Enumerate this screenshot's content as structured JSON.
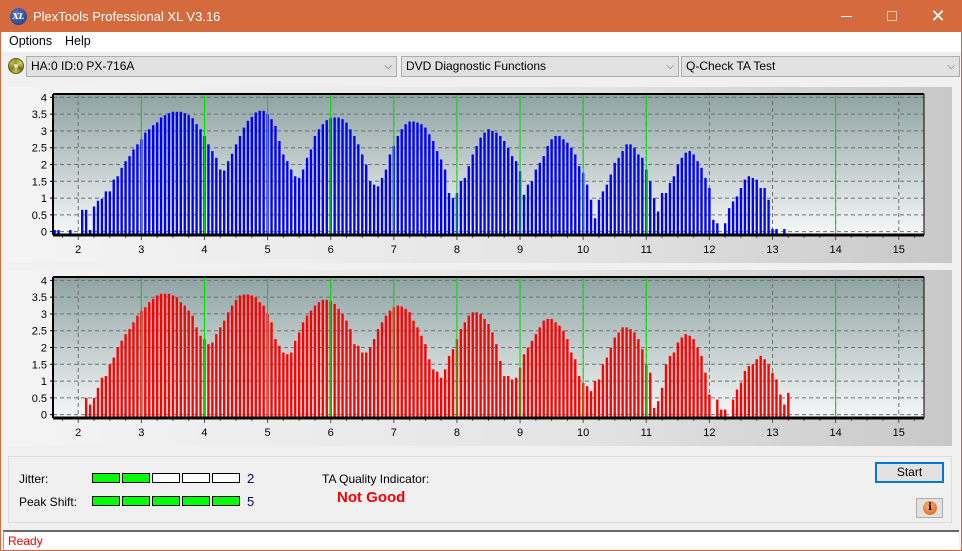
{
  "window": {
    "title": "PlexTools Professional XL V3.16",
    "app_icon_label": "XL",
    "controls": {
      "minimize": "—",
      "maximize": "☐",
      "close": "✕"
    }
  },
  "menu": {
    "items": [
      "Options",
      "Help"
    ]
  },
  "toolbar": {
    "drive": "HA:0 ID:0  PX-716A",
    "function": "DVD Diagnostic Functions",
    "test": "Q-Check TA Test",
    "chevron": "⌵"
  },
  "colors": {
    "titlebar": "#d46a3e",
    "top_bars": "#0000ff",
    "bottom_bars": "#ff0000",
    "marker_lines": "#00dd00",
    "meter_on": "#00ff00",
    "quality_bad": "#ff0000"
  },
  "chart_data": [
    {
      "type": "bar",
      "name": "top-histogram",
      "series_color": "#0000ff",
      "x_ticks": [
        2,
        3,
        4,
        5,
        6,
        7,
        8,
        9,
        10,
        11,
        12,
        13,
        14,
        15
      ],
      "y_ticks": [
        "0",
        "0.5",
        "1",
        "1.5",
        "2",
        "2.5",
        "3",
        "3.5",
        "4"
      ],
      "xlim": [
        1.6,
        15.4
      ],
      "ylim": [
        -0.1,
        4.1
      ],
      "grid": true,
      "marker_lines_x": [
        3,
        4,
        5,
        6,
        7,
        8,
        9,
        10,
        11,
        14
      ],
      "peaks": [
        {
          "center": 3,
          "height": 3.57
        },
        {
          "center": 4,
          "height": 3.6
        },
        {
          "center": 5,
          "height": 3.4
        },
        {
          "center": 6,
          "height": 3.28
        },
        {
          "center": 7,
          "height": 3.05
        },
        {
          "center": 8,
          "height": 2.85
        },
        {
          "center": 9,
          "height": 2.6
        },
        {
          "center": 10,
          "height": 2.4
        },
        {
          "center": 11,
          "height": 1.65
        },
        {
          "center": 14,
          "height": 1.85
        }
      ],
      "x_start": 1.625,
      "x_step": 0.0625,
      "values": [
        0.05,
        0.05,
        0,
        0,
        0.05,
        0,
        0,
        0.65,
        0.65,
        0.05,
        0.75,
        0.92,
        0.98,
        1.2,
        1.2,
        1.55,
        1.65,
        1.9,
        2.1,
        2.25,
        2.45,
        2.6,
        2.75,
        2.95,
        3.05,
        3.17,
        3.25,
        3.4,
        3.47,
        3.53,
        3.57,
        3.57,
        3.57,
        3.53,
        3.47,
        3.38,
        3.2,
        3.05,
        2.85,
        2.6,
        2.4,
        2.2,
        1.85,
        1.82,
        2.1,
        2.32,
        2.6,
        2.85,
        3.1,
        3.3,
        3.42,
        3.55,
        3.6,
        3.6,
        3.5,
        3.35,
        3.15,
        2.7,
        2.3,
        2.1,
        1.85,
        1.65,
        1.6,
        1.85,
        2.2,
        2.45,
        2.85,
        3.05,
        3.2,
        3.32,
        3.38,
        3.4,
        3.4,
        3.35,
        3.25,
        3.05,
        2.85,
        2.6,
        2.3,
        2.0,
        1.5,
        1.4,
        1.35,
        1.6,
        1.85,
        2.3,
        2.55,
        2.85,
        3.05,
        3.2,
        3.28,
        3.28,
        3.25,
        3.2,
        3.1,
        2.9,
        2.7,
        2.4,
        2.15,
        1.85,
        1.15,
        1.0,
        1.15,
        1.5,
        1.6,
        1.95,
        2.3,
        2.55,
        2.8,
        2.95,
        3.05,
        3.0,
        2.95,
        2.85,
        2.7,
        2.5,
        2.25,
        2.1,
        1.8,
        1.1,
        1.4,
        1.5,
        1.85,
        2.05,
        2.25,
        2.55,
        2.75,
        2.85,
        2.85,
        2.75,
        2.65,
        2.5,
        2.3,
        1.95,
        1.75,
        1.4,
        0.95,
        0.4,
        0.95,
        1.2,
        1.4,
        1.7,
        2.05,
        2.2,
        2.4,
        2.6,
        2.6,
        2.5,
        2.3,
        2.2,
        1.85,
        1.5,
        1.0,
        0.6,
        1.15,
        1.15,
        1.45,
        1.65,
        2.0,
        2.2,
        2.35,
        2.4,
        2.3,
        2.1,
        1.9,
        1.6,
        1.3,
        0.35,
        0.25,
        0,
        0.25,
        0.7,
        0.9,
        1.05,
        1.3,
        1.55,
        1.65,
        1.6,
        1.55,
        1.3,
        1.3,
        0.95,
        0.08,
        0.08,
        0,
        0.08,
        0,
        0,
        0,
        0,
        0,
        0,
        0,
        0,
        0,
        0,
        0,
        0,
        0,
        0,
        0,
        0,
        0,
        0,
        0,
        0,
        0,
        0,
        0,
        0,
        0,
        0,
        0,
        0,
        0,
        0,
        0,
        0,
        0,
        0,
        0,
        0,
        0,
        0,
        0,
        0,
        0,
        0,
        0,
        0,
        0,
        0,
        0,
        0,
        0,
        0.15,
        0.4,
        0.95,
        1.4,
        1.65,
        1.75,
        1.7,
        1.8,
        1.9,
        1.85,
        1.7,
        1.4,
        0.95,
        1.05,
        0.75,
        0,
        0.15
      ],
      "xlabel": "",
      "ylabel": ""
    },
    {
      "type": "bar",
      "name": "bottom-histogram",
      "series_color": "#ff0000",
      "x_ticks": [
        2,
        3,
        4,
        5,
        6,
        7,
        8,
        9,
        10,
        11,
        12,
        13,
        14,
        15
      ],
      "y_ticks": [
        "0",
        "0.5",
        "1",
        "1.5",
        "2",
        "2.5",
        "3",
        "3.5",
        "4"
      ],
      "xlim": [
        1.6,
        15.4
      ],
      "ylim": [
        -0.1,
        4.1
      ],
      "grid": true,
      "marker_lines_x": [
        3,
        4,
        5,
        6,
        7,
        8,
        9,
        10,
        11,
        14
      ],
      "peaks": [
        {
          "center": 3,
          "height": 3.6
        },
        {
          "center": 4,
          "height": 3.58
        },
        {
          "center": 5,
          "height": 3.42
        },
        {
          "center": 6,
          "height": 3.25
        },
        {
          "center": 7,
          "height": 3.05
        },
        {
          "center": 8,
          "height": 2.85
        },
        {
          "center": 9,
          "height": 2.6
        },
        {
          "center": 10,
          "height": 2.42
        },
        {
          "center": 11,
          "height": 1.75
        },
        {
          "center": 14,
          "height": 1.78
        }
      ],
      "x_start": 1.625,
      "x_step": 0.0625,
      "values": [
        0,
        0,
        0,
        0,
        0,
        0,
        0,
        0,
        0.5,
        0.3,
        0.5,
        0.8,
        1.1,
        1.15,
        1.5,
        1.7,
        2.0,
        2.2,
        2.4,
        2.55,
        2.75,
        2.95,
        3.1,
        3.2,
        3.35,
        3.45,
        3.55,
        3.6,
        3.6,
        3.6,
        3.55,
        3.5,
        3.35,
        3.25,
        3.1,
        2.95,
        2.6,
        2.35,
        2.25,
        2.1,
        2.15,
        2.4,
        2.6,
        2.8,
        3.05,
        3.25,
        3.42,
        3.55,
        3.58,
        3.58,
        3.55,
        3.5,
        3.35,
        3.25,
        3.0,
        2.75,
        2.25,
        2.05,
        1.85,
        1.8,
        1.85,
        2.2,
        2.45,
        2.75,
        2.95,
        3.1,
        3.25,
        3.35,
        3.42,
        3.42,
        3.38,
        3.3,
        3.15,
        3.0,
        2.8,
        2.55,
        2.1,
        2.05,
        1.85,
        1.85,
        2.0,
        2.25,
        2.55,
        2.75,
        2.95,
        3.1,
        3.2,
        3.25,
        3.22,
        3.15,
        3.05,
        2.8,
        2.6,
        2.35,
        2.1,
        1.65,
        1.35,
        1.28,
        1.1,
        1.35,
        1.75,
        1.95,
        2.25,
        2.55,
        2.75,
        2.95,
        3.05,
        3.05,
        3.0,
        2.85,
        2.7,
        2.45,
        2.1,
        1.6,
        1.15,
        1.15,
        1.05,
        1.1,
        1.4,
        1.8,
        2.0,
        2.2,
        2.4,
        2.6,
        2.8,
        2.85,
        2.85,
        2.75,
        2.65,
        2.5,
        2.25,
        1.85,
        1.65,
        1.15,
        0.95,
        0.85,
        0.7,
        1.0,
        1.05,
        1.5,
        1.7,
        2.0,
        2.3,
        2.45,
        2.6,
        2.6,
        2.55,
        2.45,
        2.25,
        1.95,
        1.5,
        1.25,
        0.2,
        0.4,
        0.8,
        1.5,
        1.75,
        1.85,
        2.15,
        2.3,
        2.4,
        2.35,
        2.25,
        2.0,
        1.75,
        1.25,
        0.6,
        0,
        0.45,
        0.15,
        0.15,
        0,
        0.45,
        0.75,
        0.95,
        1.3,
        1.45,
        1.5,
        1.65,
        1.75,
        1.65,
        1.5,
        1.25,
        1.05,
        0.6,
        0.3,
        0.65,
        0,
        0,
        0,
        0,
        0,
        0,
        0,
        0,
        0,
        0,
        0,
        0,
        0,
        0,
        0,
        0,
        0,
        0,
        0,
        0,
        0,
        0,
        0,
        0,
        0,
        0,
        0,
        0,
        0,
        0,
        0,
        0,
        0,
        0,
        0,
        0,
        0,
        0,
        0,
        0,
        0,
        0,
        0,
        0,
        0,
        0,
        0,
        0,
        0,
        0,
        0,
        0,
        0,
        0.15,
        0.6,
        0.8,
        1.15,
        1.5,
        1.75,
        1.75,
        1.75,
        1.7,
        1.5,
        1.45,
        1.2,
        0.85,
        0.95,
        0.15
      ],
      "xlabel": "",
      "ylabel": ""
    }
  ],
  "results": {
    "jitter_label": "Jitter:",
    "jitter_value": "2",
    "jitter_level": 2,
    "peak_shift_label": "Peak Shift:",
    "peak_shift_value": "5",
    "peak_shift_level": 5,
    "meter_segments": 5,
    "ta_quality_label": "TA Quality Indicator:",
    "ta_quality_value": "Not Good"
  },
  "buttons": {
    "start": "Start",
    "info": "i"
  },
  "status": {
    "text": "Ready"
  }
}
